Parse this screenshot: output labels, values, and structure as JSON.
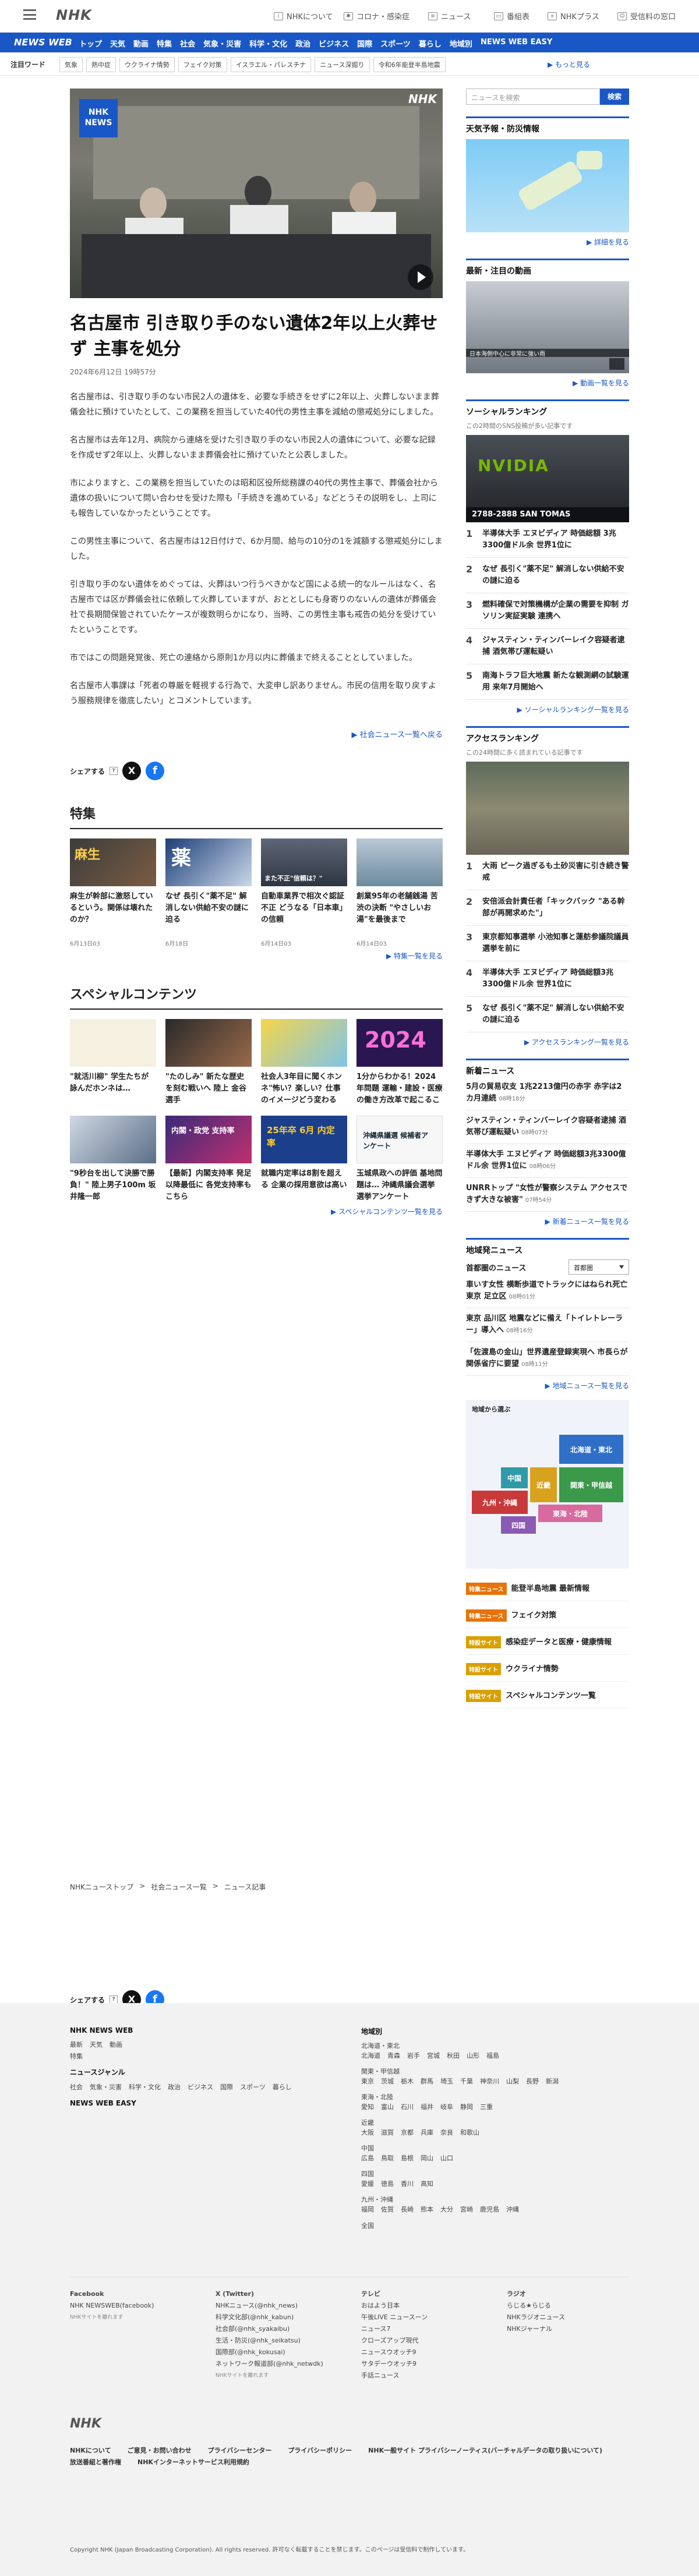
{
  "header": {
    "logo": "NHK",
    "nav": [
      {
        "icon": "info-icon",
        "label": "NHKについて"
      },
      {
        "icon": "virus-icon",
        "label": "コロナ・感染症"
      },
      {
        "icon": "news-icon",
        "label": "ニュース"
      },
      {
        "icon": "tv-icon",
        "label": "番組表"
      },
      {
        "icon": "plus-icon",
        "label": "NHKプラス"
      },
      {
        "icon": "user-icon",
        "label": "受信料の窓口"
      }
    ]
  },
  "subnav": {
    "brand": "NEWS WEB",
    "categories": [
      "トップ",
      "天気",
      "動画",
      "特集",
      "社会",
      "気象・災害",
      "科学・文化",
      "政治",
      "ビジネス",
      "国際",
      "スポーツ",
      "暮らし",
      "地域別",
      "NEWS WEB EASY"
    ]
  },
  "keywords": {
    "title": "注目ワード",
    "items": [
      "気象",
      "熱中症",
      "ウクライナ情勢",
      "フェイク対策",
      "イスラエル・パレスチナ",
      "ニュース深掘り",
      "令和6年能登半島地震"
    ],
    "more": "もっと見る"
  },
  "article": {
    "hero_badge": "NHK NEWS",
    "hero_logo": "NHK",
    "headline": "名古屋市 引き取り手のない遺体2年以上火葬せず 主事を処分",
    "date": "2024年6月12日 19時57分",
    "paragraphs": [
      "名古屋市は、引き取り手のない市民2人の遺体を、必要な手続きをせずに2年以上、火葬しないまま葬儀会社に預けていたとして、この業務を担当していた40代の男性主事を減給の懲戒処分にしました。",
      "名古屋市は去年12月、病院から連絡を受けた引き取り手のない市民2人の遺体について、必要な記録を作成せず2年以上、火葬しないまま葬儀会社に預けていたと公表しました。",
      "市によりますと、この業務を担当していたのは昭和区役所総務課の40代の男性主事で、葬儀会社から遺体の扱いについて問い合わせを受けた際も「手続きを進めている」などとうその説明をし、上司にも報告していなかったということです。",
      "この男性主事について、名古屋市は12日付けで、6か月間、給与の10分の1を減額する懲戒処分にしました。",
      "引き取り手のない遺体をめぐっては、火葬はいつ行うべきかなど国による統一的なルールはなく、名古屋市では区が葬儀会社に依頼して火葬していますが、おととしにも身寄りのないんの遺体が葬儀会社で長期間保管されていたケースが複数明らかになり、当時、この男性主事も戒告の処分を受けていたということです。",
      "市ではこの問題発覚後、死亡の連絡から原則1か月以内に葬儀まで終えることとしていました。",
      "名古屋市人事課は「死者の尊厳を軽視する行為で、大変申し訳ありません。市民の信用を取り戻すよう服務規律を徹底したい」とコメントしています。"
    ],
    "back": "社会ニュース一覧へ戻る"
  },
  "share": {
    "label": "シェアする",
    "x": "X",
    "fb": "f"
  },
  "tokushu": {
    "title": "特集",
    "items": [
      {
        "title": "麻生が幹部に激怒しているという。関係は壊れたのか？",
        "date": "6月13日03"
      },
      {
        "title": "なぜ 長引く\"薬不足\" 解消しない供給不安の謎に迫る",
        "date": "6月18日"
      },
      {
        "title": "自動車業界で相次ぐ認証不正 どうなる「日本車」の信頼",
        "date": "6月14日03"
      },
      {
        "title": "創業95年の老舗銭湯 苦渋の決断 \"やさしいお湯\"を最後まで",
        "date": "6月14日03"
      }
    ],
    "more": "特集一覧を見る",
    "thumb_texts": [
      "麻生",
      "薬",
      "",
      "",
      "また不正\"信頼は？\""
    ]
  },
  "special": {
    "title": "スペシャルコンテンツ",
    "items": [
      {
        "title": "\"就活川柳\" 学生たちが詠んだホンネは…"
      },
      {
        "title": "\"たのしみ\" 新たな歴史を刻む戦いへ 陸上 金谷選手"
      },
      {
        "title": "社会人3年目に聞くホンネ\"怖い？楽しい？仕事のイメージどう変わる"
      },
      {
        "title": "1分からわかる！2024年問題 運輸・建設・医療の働き方改革で起こること"
      },
      {
        "title": "\"9秒台を出して決勝で勝負！\" 陸上男子100m 坂井隆一郎"
      },
      {
        "title": "【最新】内閣支持率 発足以降最低に 各党支持率もこちら"
      },
      {
        "title": "就職内定率は8割を超える 企業の採用意欲は高い"
      },
      {
        "title": "玉城県政への評価 基地問題は… 沖縄県議会選挙 選挙アンケート"
      }
    ],
    "more": "スペシャルコンテンツ一覧を見る",
    "thumb_texts": [
      "2024",
      "内閣・政党 支持率",
      "25年卒 6月 内定率",
      "沖縄県議選 候補者アンケート"
    ]
  },
  "side": {
    "search_placeholder": "ニュースを検索",
    "search_btn": "検索",
    "weather": {
      "title": "天気予報・防災情報",
      "link": "詳細を見る"
    },
    "video": {
      "title": "最新・注目の動画",
      "caption": "日本海側中心に非常に強い雨",
      "link": "動画一覧を見る"
    },
    "social": {
      "title": "ソーシャルランキング",
      "sub": "この2時間のSNS投稿が多い記事です",
      "banner": "2788-2888 SAN TOMAS",
      "items": [
        "半導体大手 エヌビディア 時価総額 3兆3300億ドル余 世界1位に",
        "なぜ 長引く\"薬不足\" 解消しない供給不安の謎に迫る",
        "燃料確保で対策機構が企業の需要を抑制 ガソリン実証実験 連携へ",
        "ジャスティン・ティンバーレイク容疑者逮捕 酒気帯び運転疑い",
        "南海トラフ巨大地震 新たな観測網の試験運用 来年7月開始へ"
      ],
      "link": "ソーシャルランキング一覧を見る"
    },
    "access": {
      "title": "アクセスランキング",
      "sub": "この24時間に多く読まれている記事です",
      "items": [
        "大雨 ピーク過ぎるも土砂災害に引き続き警戒",
        "安倍派会計責任者「キックバック \"ある幹部が再開求めた\"」",
        "東京都知事選挙 小池知事と蓮舫参議院議員 選挙を前に",
        "半導体大手 エヌビディア 時価総額3兆3300億ドル余 世界1位に",
        "なぜ 長引く\"薬不足\" 解消しない供給不安の謎に迫る"
      ],
      "link": "アクセスランキング一覧を見る"
    },
    "latest": {
      "title": "新着ニュース",
      "items": [
        {
          "t": "5月の貿易収支 1兆2213億円の赤字 赤字は2カ月連続",
          "tm": "08時18分"
        },
        {
          "t": "ジャスティン・ティンバーレイク容疑者逮捕 酒気帯び運転疑い",
          "tm": "08時07分"
        },
        {
          "t": "半導体大手 エヌビディア 時価総額3兆3300億ドル余 世界1位に",
          "tm": "08時06分"
        },
        {
          "t": "UNRRトップ \"女性が警察システム アクセスできず大きな被害\"",
          "tm": "07時54分"
        }
      ],
      "link": "新着ニュース一覧を見る"
    },
    "local": {
      "title": "地域発ニュース",
      "select_label": "首都圏のニュース",
      "select_value": "首都圏",
      "items": [
        {
          "t": "車いす女性 横断歩道でトラックにはねられ死亡 東京 足立区",
          "tm": "08時01分"
        },
        {
          "t": "東京 品川区 地震などに備え「トイレトレーラー」導入へ",
          "tm": "08時16分"
        },
        {
          "t": "「佐渡島の金山」世界遺産登録実現へ 市長らが関係省庁に要望",
          "tm": "08時11分"
        }
      ],
      "link": "地域ニュース一覧を見る",
      "map_title": "地域から選ぶ",
      "regions": [
        "北海道・東北",
        "関東・甲信越",
        "近畿",
        "中国",
        "九州・沖縄",
        "四国",
        "東海・北陸"
      ]
    },
    "specials": [
      {
        "tag": "特集ニュース",
        "color": "#e8730a",
        "t": "能登半島地震 最新情報"
      },
      {
        "tag": "特集ニュース",
        "color": "#e8730a",
        "t": "フェイク対策"
      },
      {
        "tag": "特設サイト",
        "color": "#d9a000",
        "t": "感染症データと医療・健康情報"
      },
      {
        "tag": "特設サイト",
        "color": "#d9a000",
        "t": "ウクライナ情勢"
      },
      {
        "tag": "特設サイト",
        "color": "#d9a000",
        "t": "スペシャルコンテンツ一覧"
      }
    ]
  },
  "breadcrumb": [
    "NHKニューストップ",
    "社会ニュース一覧",
    "ニュース記事"
  ],
  "footer": {
    "news_web": "NHK NEWS WEB",
    "cols1": [
      "最新",
      "天気",
      "動画",
      "特集"
    ],
    "genre_title": "ニュースジャンル",
    "genres": [
      "社会",
      "気象・災害",
      "科学・文化",
      "政治",
      "ビジネス",
      "国際",
      "スポーツ",
      "暮らし"
    ],
    "easy": "NEWS WEB EASY",
    "local_title": "地域別",
    "areas": [
      {
        "h": "北海道・東北",
        "items": [
          "北海道",
          "青森",
          "岩手",
          "宮城",
          "秋田",
          "山形",
          "福島"
        ]
      },
      {
        "h": "関東・甲信越",
        "items": [
          "東京",
          "茨城",
          "栃木",
          "群馬",
          "埼玉",
          "千葉",
          "神奈川",
          "山梨",
          "長野",
          "新潟"
        ]
      },
      {
        "h": "東海・北陸",
        "items": [
          "愛知",
          "富山",
          "石川",
          "福井",
          "岐阜",
          "静岡",
          "三重"
        ]
      },
      {
        "h": "近畿",
        "items": [
          "大阪",
          "滋賀",
          "京都",
          "兵庫",
          "奈良",
          "和歌山"
        ]
      },
      {
        "h": "中国",
        "items": [
          "広島",
          "鳥取",
          "島根",
          "岡山",
          "山口"
        ]
      },
      {
        "h": "四国",
        "items": [
          "愛媛",
          "徳島",
          "香川",
          "高知"
        ]
      },
      {
        "h": "九州・沖縄",
        "items": [
          "福岡",
          "佐賀",
          "長崎",
          "熊本",
          "大分",
          "宮崎",
          "鹿児島",
          "沖縄"
        ]
      },
      {
        "h": "",
        "items": [
          "全国"
        ]
      }
    ],
    "fb_title": "Facebook",
    "fb_items": [
      "NHK NEWSWEB(facebook)",
      "NHKサイトを離れます"
    ],
    "x_title": "X (Twitter)",
    "x_items": [
      "NHKニュース(@nhk_news)",
      "科学文化部(@nhk_kabun)",
      "社会部(@nhk_syakaibu)",
      "生活・防災(@nhk_seikatsu)",
      "国際部(@nhk_kokusai)",
      "ネットワーク報道部(@nhk_netwdk)",
      "NHKサイトを離れます"
    ],
    "tv_title": "テレビ",
    "tv_items": [
      "おはよう日本",
      "午後LIVE ニュースーン",
      "ニュース7",
      "クローズアップ現代",
      "ニュースウオッチ9",
      "サタデーウオッチ9",
      "手話ニュース"
    ],
    "radio_title": "ラジオ",
    "radio_items": [
      "らじる★らじる",
      "NHKラジオニュース",
      "NHKジャーナル"
    ],
    "logo": "NHK",
    "bottom_links": [
      "NHKについて",
      "ご意見・お問い合わせ",
      "プライバシーセンター",
      "プライバシーポリシー",
      "NHK一般サイト プライバシーノーティス(バーチャルデータの取り扱いについて)",
      "放送番組と著作権",
      "NHKインターネットサービス利用規約"
    ],
    "copyright": "Copyright NHK (Japan Broadcasting Corporation). All rights reserved. 許可なく転載することを禁じます。このページは受信料で制作しています。"
  }
}
